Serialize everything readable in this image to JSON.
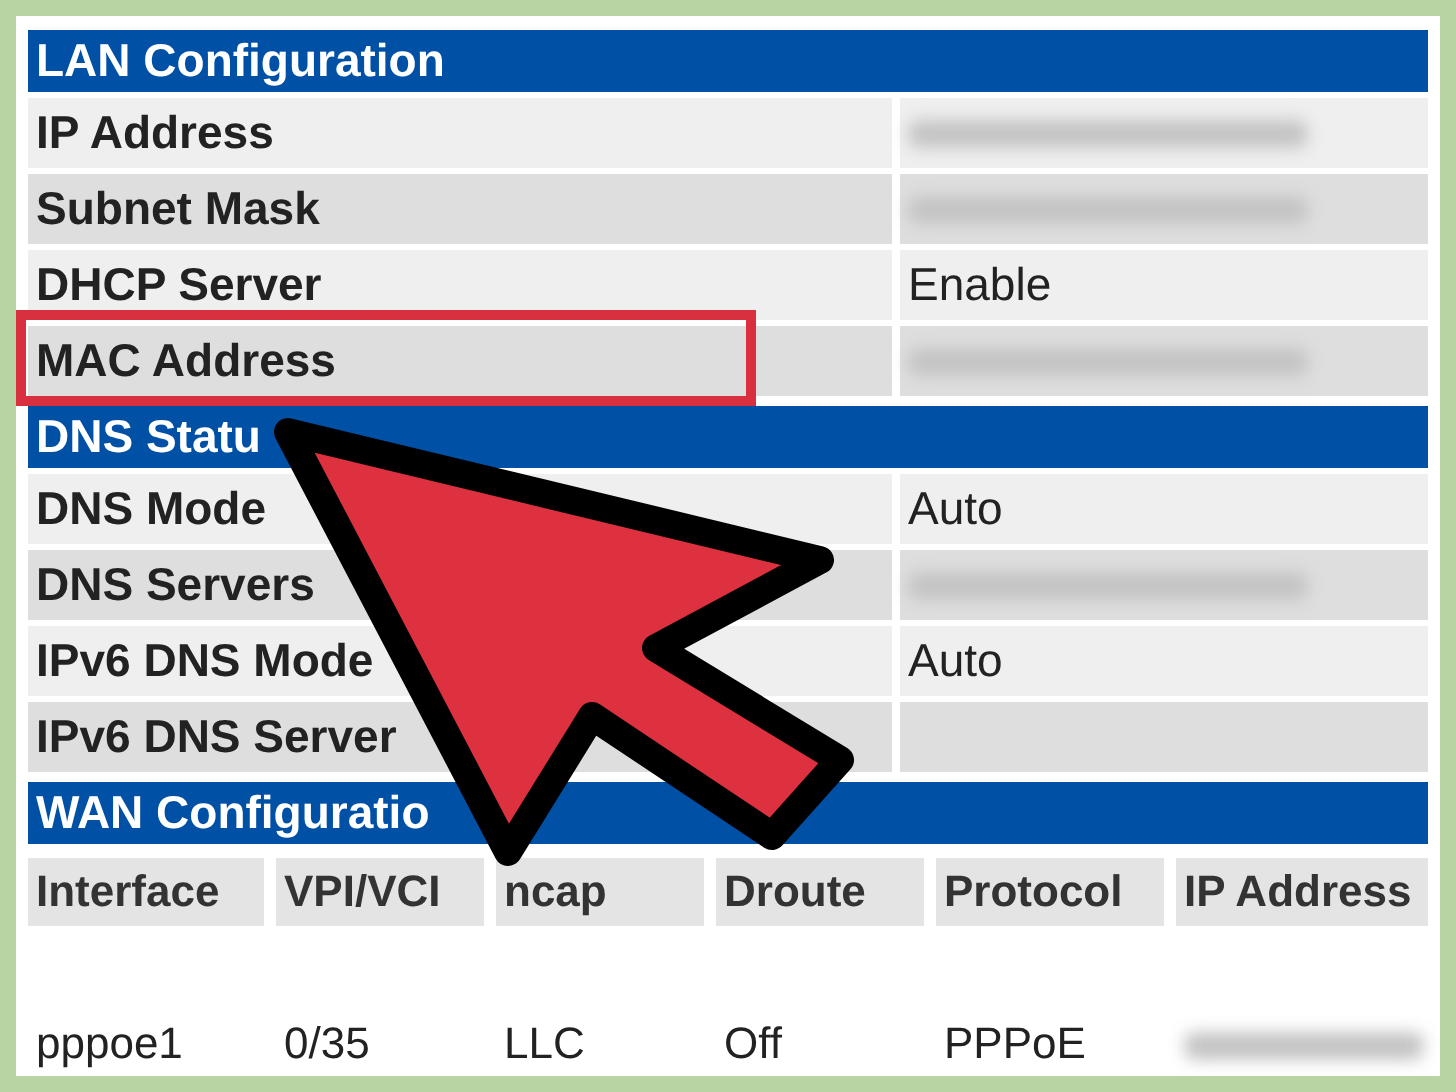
{
  "sections": [
    {
      "title": "LAN Configuration",
      "rows": [
        {
          "label": "IP Address",
          "value": {
            "kind": "blurred"
          }
        },
        {
          "label": "Subnet Mask",
          "value": {
            "kind": "blurred"
          }
        },
        {
          "label": "DHCP Server",
          "value": {
            "kind": "text",
            "text": "Enable"
          }
        },
        {
          "label": "MAC Address",
          "value": {
            "kind": "blurred"
          },
          "highlighted": true
        }
      ]
    },
    {
      "title": "DNS Statu",
      "rows": [
        {
          "label": "DNS Mode",
          "value": {
            "kind": "text",
            "text": "Auto"
          }
        },
        {
          "label": "DNS Servers",
          "value": {
            "kind": "blurred"
          }
        },
        {
          "label": "IPv6 DNS Mode",
          "value": {
            "kind": "text",
            "text": "Auto"
          }
        },
        {
          "label": "IPv6 DNS Server"
        }
      ]
    }
  ],
  "wan": {
    "title": "WAN Configuratio",
    "columns": [
      "Interface",
      "VPI/VCI",
      "ncap",
      "Droute",
      "Protocol",
      "IP Address"
    ],
    "rows": [
      {
        "cells": [
          {
            "kind": "text",
            "text": "pppoe1"
          },
          {
            "kind": "text",
            "text": "0/35"
          },
          {
            "kind": "text",
            "text": "LLC"
          },
          {
            "kind": "text",
            "text": "Off"
          },
          {
            "kind": "text",
            "text": "PPPoE"
          },
          {
            "kind": "blurred"
          }
        ]
      }
    ]
  }
}
